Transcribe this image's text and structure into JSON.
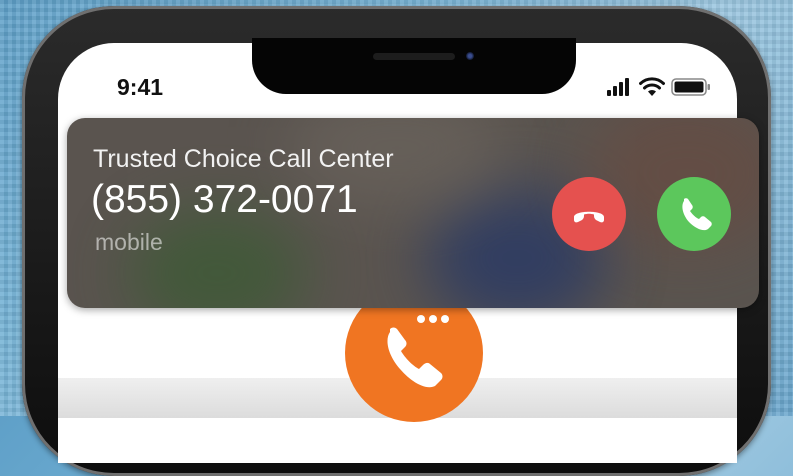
{
  "status_bar": {
    "time": "9:41",
    "icons": [
      "signal-icon",
      "wifi-icon",
      "battery-icon"
    ]
  },
  "incoming_call": {
    "caller_name": "Trusted Choice Call Center",
    "phone_number": "(855) 372-0071",
    "number_type": "mobile",
    "actions": [
      {
        "name": "decline",
        "icon": "phone-hangup-icon",
        "color": "#e5514f"
      },
      {
        "name": "accept",
        "icon": "phone-icon",
        "color": "#5cc75c"
      }
    ]
  },
  "app": {
    "icon": "phone-chat-icon",
    "accent_color": "#f07522"
  }
}
